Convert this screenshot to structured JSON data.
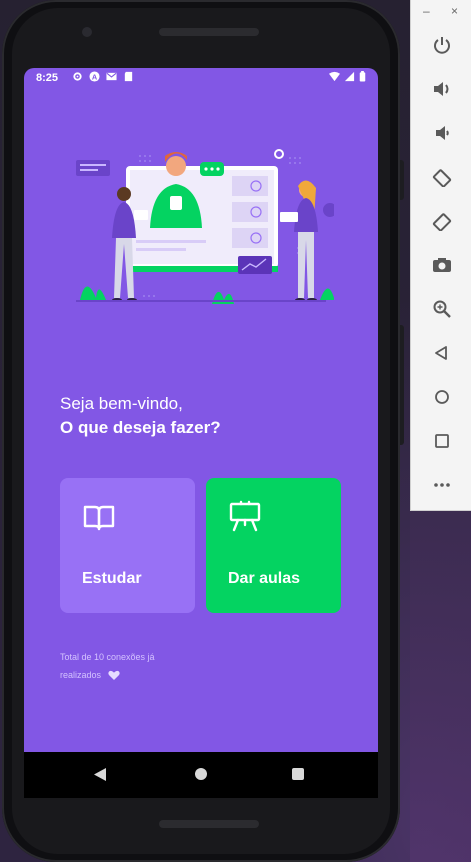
{
  "status_bar": {
    "time": "8:25",
    "icons_left": [
      "settings-icon",
      "accessibility-icon",
      "mail-icon",
      "sd-card-icon"
    ],
    "icons_right": [
      "wifi-icon",
      "signal-icon",
      "battery-icon"
    ]
  },
  "landing": {
    "greeting": "Seja bem-vindo,",
    "question": "O que deseja fazer?",
    "study_button": {
      "label": "Estudar",
      "icon": "book-open-icon",
      "color": "#9871f5"
    },
    "teach_button": {
      "label": "Dar aulas",
      "icon": "presentation-board-icon",
      "color": "#04d361"
    },
    "connections_line1": "Total de 10 conexões já",
    "connections_line2": "realizados",
    "connections_icon": "heart-icon"
  },
  "colors": {
    "background": "#8257e5",
    "secondary": "#04d361",
    "primary_lighter": "#9871f5"
  },
  "android_nav": {
    "back": "back-triangle-icon",
    "home": "home-circle-icon",
    "recents": "recents-square-icon"
  },
  "emulator_toolbar": {
    "minimize": "–",
    "close": "×",
    "buttons": [
      "power-icon",
      "volume-up-icon",
      "volume-down-icon",
      "rotate-left-icon",
      "rotate-right-icon",
      "camera-icon",
      "zoom-icon",
      "back-icon",
      "home-icon",
      "overview-icon",
      "more-icon"
    ]
  }
}
